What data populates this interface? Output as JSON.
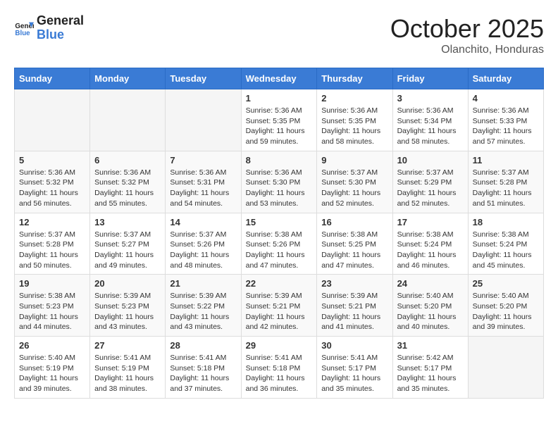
{
  "header": {
    "logo_line1": "General",
    "logo_line2": "Blue",
    "month": "October 2025",
    "location": "Olanchito, Honduras"
  },
  "days_of_week": [
    "Sunday",
    "Monday",
    "Tuesday",
    "Wednesday",
    "Thursday",
    "Friday",
    "Saturday"
  ],
  "weeks": [
    [
      {
        "day": "",
        "sunrise": "",
        "sunset": "",
        "daylight": ""
      },
      {
        "day": "",
        "sunrise": "",
        "sunset": "",
        "daylight": ""
      },
      {
        "day": "",
        "sunrise": "",
        "sunset": "",
        "daylight": ""
      },
      {
        "day": "1",
        "sunrise": "Sunrise: 5:36 AM",
        "sunset": "Sunset: 5:35 PM",
        "daylight": "Daylight: 11 hours and 59 minutes."
      },
      {
        "day": "2",
        "sunrise": "Sunrise: 5:36 AM",
        "sunset": "Sunset: 5:35 PM",
        "daylight": "Daylight: 11 hours and 58 minutes."
      },
      {
        "day": "3",
        "sunrise": "Sunrise: 5:36 AM",
        "sunset": "Sunset: 5:34 PM",
        "daylight": "Daylight: 11 hours and 58 minutes."
      },
      {
        "day": "4",
        "sunrise": "Sunrise: 5:36 AM",
        "sunset": "Sunset: 5:33 PM",
        "daylight": "Daylight: 11 hours and 57 minutes."
      }
    ],
    [
      {
        "day": "5",
        "sunrise": "Sunrise: 5:36 AM",
        "sunset": "Sunset: 5:32 PM",
        "daylight": "Daylight: 11 hours and 56 minutes."
      },
      {
        "day": "6",
        "sunrise": "Sunrise: 5:36 AM",
        "sunset": "Sunset: 5:32 PM",
        "daylight": "Daylight: 11 hours and 55 minutes."
      },
      {
        "day": "7",
        "sunrise": "Sunrise: 5:36 AM",
        "sunset": "Sunset: 5:31 PM",
        "daylight": "Daylight: 11 hours and 54 minutes."
      },
      {
        "day": "8",
        "sunrise": "Sunrise: 5:36 AM",
        "sunset": "Sunset: 5:30 PM",
        "daylight": "Daylight: 11 hours and 53 minutes."
      },
      {
        "day": "9",
        "sunrise": "Sunrise: 5:37 AM",
        "sunset": "Sunset: 5:30 PM",
        "daylight": "Daylight: 11 hours and 52 minutes."
      },
      {
        "day": "10",
        "sunrise": "Sunrise: 5:37 AM",
        "sunset": "Sunset: 5:29 PM",
        "daylight": "Daylight: 11 hours and 52 minutes."
      },
      {
        "day": "11",
        "sunrise": "Sunrise: 5:37 AM",
        "sunset": "Sunset: 5:28 PM",
        "daylight": "Daylight: 11 hours and 51 minutes."
      }
    ],
    [
      {
        "day": "12",
        "sunrise": "Sunrise: 5:37 AM",
        "sunset": "Sunset: 5:28 PM",
        "daylight": "Daylight: 11 hours and 50 minutes."
      },
      {
        "day": "13",
        "sunrise": "Sunrise: 5:37 AM",
        "sunset": "Sunset: 5:27 PM",
        "daylight": "Daylight: 11 hours and 49 minutes."
      },
      {
        "day": "14",
        "sunrise": "Sunrise: 5:37 AM",
        "sunset": "Sunset: 5:26 PM",
        "daylight": "Daylight: 11 hours and 48 minutes."
      },
      {
        "day": "15",
        "sunrise": "Sunrise: 5:38 AM",
        "sunset": "Sunset: 5:26 PM",
        "daylight": "Daylight: 11 hours and 47 minutes."
      },
      {
        "day": "16",
        "sunrise": "Sunrise: 5:38 AM",
        "sunset": "Sunset: 5:25 PM",
        "daylight": "Daylight: 11 hours and 47 minutes."
      },
      {
        "day": "17",
        "sunrise": "Sunrise: 5:38 AM",
        "sunset": "Sunset: 5:24 PM",
        "daylight": "Daylight: 11 hours and 46 minutes."
      },
      {
        "day": "18",
        "sunrise": "Sunrise: 5:38 AM",
        "sunset": "Sunset: 5:24 PM",
        "daylight": "Daylight: 11 hours and 45 minutes."
      }
    ],
    [
      {
        "day": "19",
        "sunrise": "Sunrise: 5:38 AM",
        "sunset": "Sunset: 5:23 PM",
        "daylight": "Daylight: 11 hours and 44 minutes."
      },
      {
        "day": "20",
        "sunrise": "Sunrise: 5:39 AM",
        "sunset": "Sunset: 5:23 PM",
        "daylight": "Daylight: 11 hours and 43 minutes."
      },
      {
        "day": "21",
        "sunrise": "Sunrise: 5:39 AM",
        "sunset": "Sunset: 5:22 PM",
        "daylight": "Daylight: 11 hours and 43 minutes."
      },
      {
        "day": "22",
        "sunrise": "Sunrise: 5:39 AM",
        "sunset": "Sunset: 5:21 PM",
        "daylight": "Daylight: 11 hours and 42 minutes."
      },
      {
        "day": "23",
        "sunrise": "Sunrise: 5:39 AM",
        "sunset": "Sunset: 5:21 PM",
        "daylight": "Daylight: 11 hours and 41 minutes."
      },
      {
        "day": "24",
        "sunrise": "Sunrise: 5:40 AM",
        "sunset": "Sunset: 5:20 PM",
        "daylight": "Daylight: 11 hours and 40 minutes."
      },
      {
        "day": "25",
        "sunrise": "Sunrise: 5:40 AM",
        "sunset": "Sunset: 5:20 PM",
        "daylight": "Daylight: 11 hours and 39 minutes."
      }
    ],
    [
      {
        "day": "26",
        "sunrise": "Sunrise: 5:40 AM",
        "sunset": "Sunset: 5:19 PM",
        "daylight": "Daylight: 11 hours and 39 minutes."
      },
      {
        "day": "27",
        "sunrise": "Sunrise: 5:41 AM",
        "sunset": "Sunset: 5:19 PM",
        "daylight": "Daylight: 11 hours and 38 minutes."
      },
      {
        "day": "28",
        "sunrise": "Sunrise: 5:41 AM",
        "sunset": "Sunset: 5:18 PM",
        "daylight": "Daylight: 11 hours and 37 minutes."
      },
      {
        "day": "29",
        "sunrise": "Sunrise: 5:41 AM",
        "sunset": "Sunset: 5:18 PM",
        "daylight": "Daylight: 11 hours and 36 minutes."
      },
      {
        "day": "30",
        "sunrise": "Sunrise: 5:41 AM",
        "sunset": "Sunset: 5:17 PM",
        "daylight": "Daylight: 11 hours and 35 minutes."
      },
      {
        "day": "31",
        "sunrise": "Sunrise: 5:42 AM",
        "sunset": "Sunset: 5:17 PM",
        "daylight": "Daylight: 11 hours and 35 minutes."
      },
      {
        "day": "",
        "sunrise": "",
        "sunset": "",
        "daylight": ""
      }
    ]
  ]
}
